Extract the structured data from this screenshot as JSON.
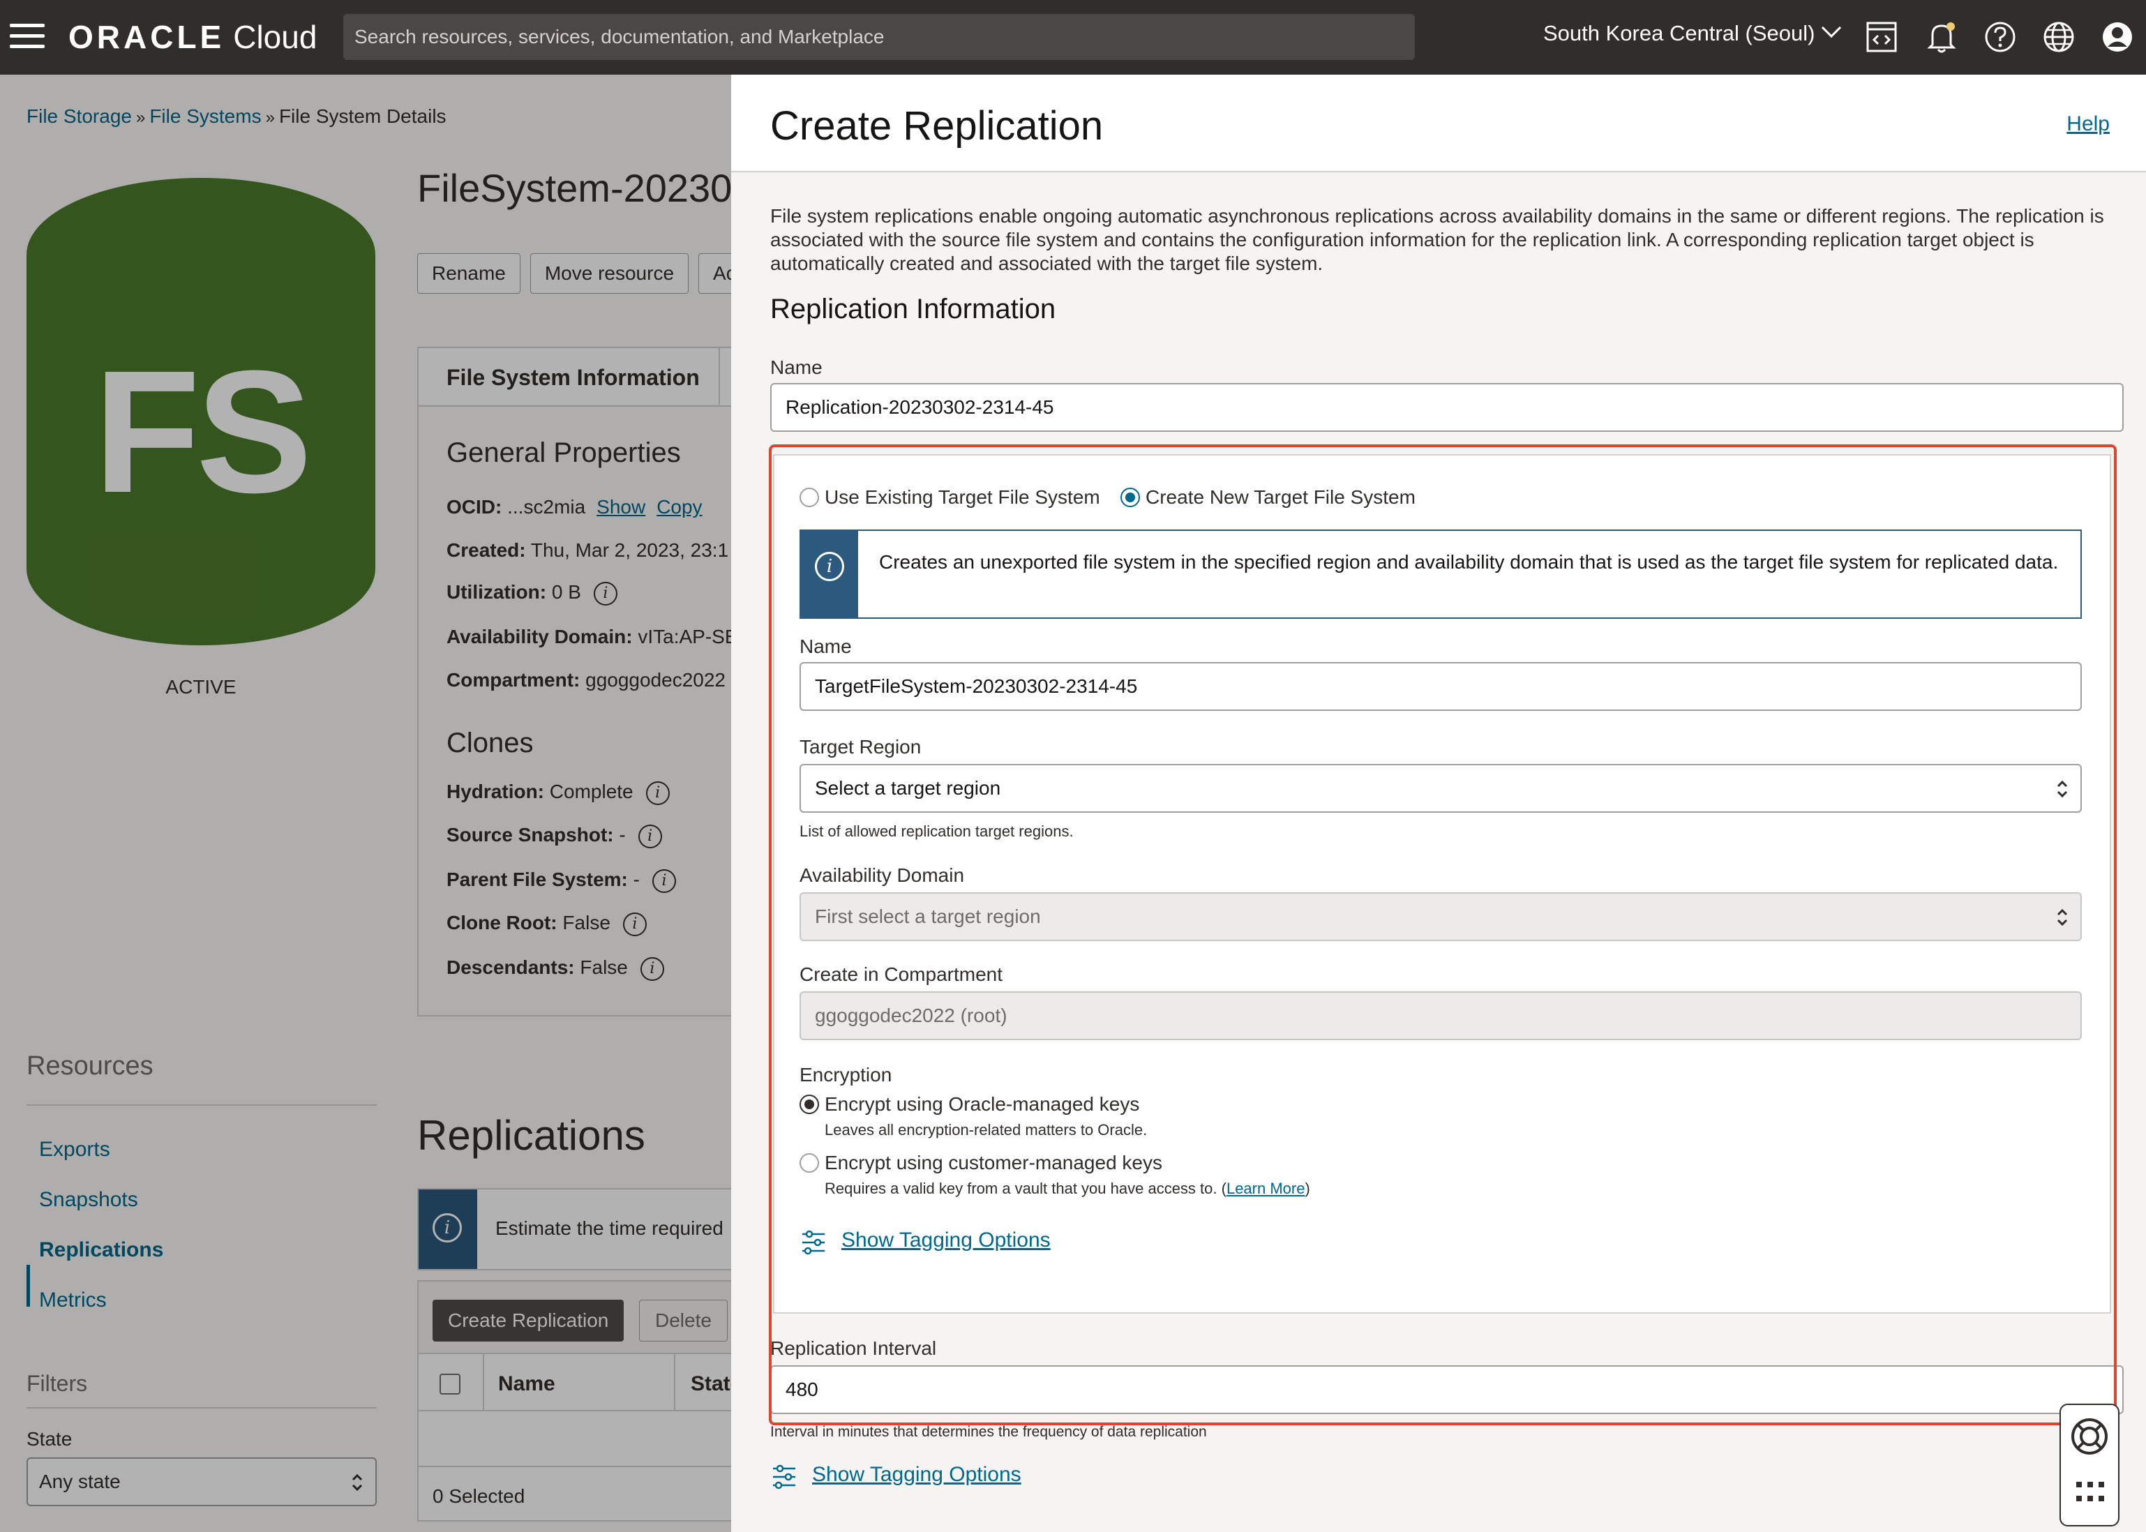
{
  "topbar": {
    "logo_brand": "ORACLE",
    "logo_product": "Cloud",
    "search_placeholder": "Search resources, services, documentation, and Marketplace",
    "region": "South Korea Central (Seoul)",
    "icons": [
      "menu-icon",
      "code-editor-icon",
      "bell-icon",
      "help-icon",
      "globe-icon",
      "user-icon"
    ]
  },
  "background": {
    "breadcrumb": [
      "File Storage",
      "File Systems",
      "File System Details"
    ],
    "breadcrumb_sep": "»",
    "badge_text": "FS",
    "status": "ACTIVE",
    "title": "FileSystem-20230",
    "actions": [
      "Rename",
      "Move resource",
      "Ac"
    ],
    "tab_label": "File System Information",
    "general_heading": "General Properties",
    "ocid_label": "OCID:",
    "ocid_value": "...sc2mia",
    "ocid_show": "Show",
    "ocid_copy": "Copy",
    "created_label": "Created:",
    "created_value": "Thu, Mar 2, 2023, 23:1",
    "util_label": "Utilization:",
    "util_value": "0 B",
    "ad_label": "Availability Domain:",
    "ad_value": "vITa:AP-SE",
    "comp_label": "Compartment:",
    "comp_value": "ggoggodec2022",
    "clones_heading": "Clones",
    "hydration_label": "Hydration:",
    "hydration_value": "Complete",
    "snapshot_label": "Source Snapshot:",
    "snapshot_value": "-",
    "parent_label": "Parent File System:",
    "parent_value": "-",
    "root_label": "Clone Root:",
    "root_value": "False",
    "desc_label": "Descendants:",
    "desc_value": "False",
    "resources_heading": "Resources",
    "resources": [
      "Exports",
      "Snapshots",
      "Replications",
      "Metrics"
    ],
    "filters_heading": "Filters",
    "state_label": "State",
    "state_value": "Any state",
    "replications_heading": "Replications",
    "estimate_text": "Estimate the time required",
    "create_btn": "Create Replication",
    "delete_btn": "Delete",
    "col_name": "Name",
    "col_state": "State",
    "selected": "0 Selected"
  },
  "panel": {
    "title": "Create Replication",
    "help": "Help",
    "description": "File system replications enable ongoing automatic asynchronous replications across availability domains in the same or different regions. The replication is associated with the source file system and contains the configuration information for the replication link. A corresponding replication target object is automatically created and associated with the target file system.",
    "section_heading": "Replication Information",
    "name_label": "Name",
    "name_value": "Replication-20230302-2314-45",
    "target_option_existing": "Use Existing Target File System",
    "target_option_new": "Create New Target File System",
    "callout": "Creates an unexported file system in the specified region and availability domain that is used as the target file system for replicated data.",
    "target_name_label": "Name",
    "target_name_value": "TargetFileSystem-20230302-2314-45",
    "region_label": "Target Region",
    "region_placeholder": "Select a target region",
    "region_hint": "List of allowed replication target regions.",
    "ad_label": "Availability Domain",
    "ad_placeholder": "First select a target region",
    "compartment_label": "Create in Compartment",
    "compartment_value": "ggoggodec2022 (root)",
    "encryption_label": "Encryption",
    "enc_oracle": "Encrypt using Oracle-managed keys",
    "enc_oracle_hint": "Leaves all encryption-related matters to Oracle.",
    "enc_customer": "Encrypt using customer-managed keys",
    "enc_customer_hint_pre": "Requires a valid key from a vault that you have access to. (",
    "enc_customer_hint_link": "Learn More",
    "enc_customer_hint_post": ")",
    "tagging_inner": "Show Tagging Options",
    "interval_label": "Replication Interval",
    "interval_value": "480",
    "interval_hint": "Interval in minutes that determines the frequency of data replication",
    "tagging_outer": "Show Tagging Options"
  },
  "colors": {
    "topbar": "#312d2a",
    "link": "#00688c",
    "badge_green": "#4d7a2b",
    "info_blue": "#2b5a7e",
    "highlight_red": "#e0442e"
  }
}
